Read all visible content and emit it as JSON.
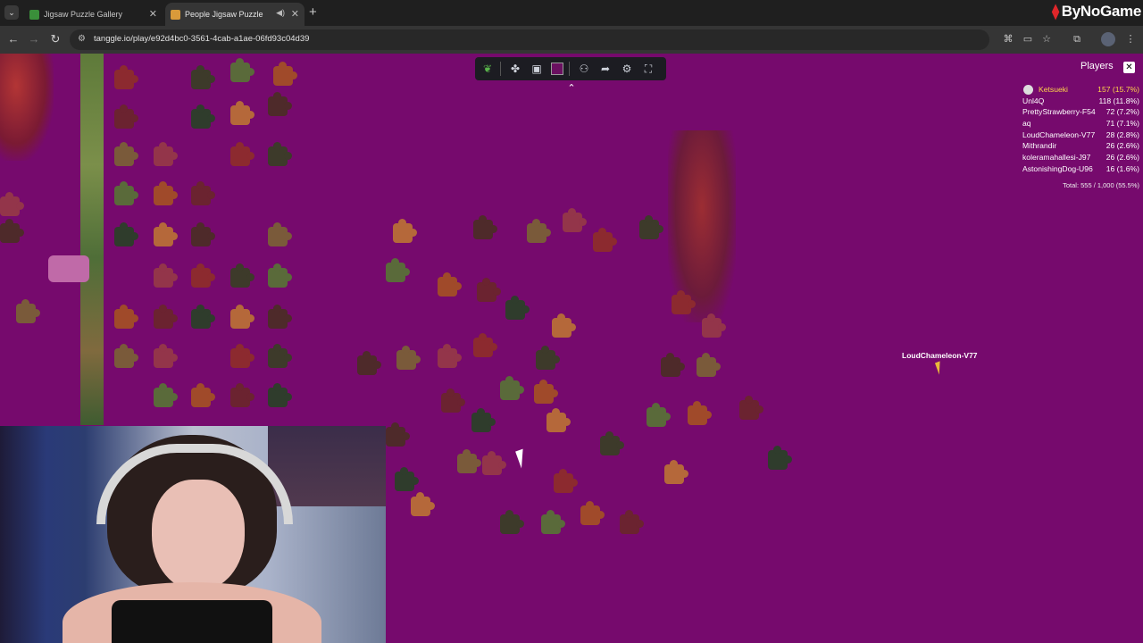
{
  "browser": {
    "tabs": [
      {
        "title": "Jigsaw Puzzle Gallery",
        "active": false
      },
      {
        "title": "People Jigsaw Puzzle",
        "active": true
      }
    ],
    "url": "tanggle.io/play/e92d4bc0-3561-4cab-a1ae-06fd93c04d39",
    "brand": "ByNoGame"
  },
  "game": {
    "players_title": "Players",
    "players": [
      {
        "name": "Ketsueki",
        "score": "157 (15.7%)",
        "leader": true
      },
      {
        "name": "Unl4Q",
        "score": "118 (11.8%)"
      },
      {
        "name": "PrettyStrawberry-F54",
        "score": "72 (7.2%)"
      },
      {
        "name": "aq",
        "score": "71 (7.1%)"
      },
      {
        "name": "LoudChameleon-V77",
        "score": "28 (2.8%)"
      },
      {
        "name": "Mithrandir",
        "score": "26 (2.6%)"
      },
      {
        "name": "koleramahallesi-J97",
        "score": "26 (2.6%)"
      },
      {
        "name": "AstonishingDog-U96",
        "score": "16 (1.6%)"
      }
    ],
    "total": "Total: 555 / 1,000 (55.5%)",
    "remote_cursor_label": "LoudChameleon-V77",
    "background_color": "#760a6d",
    "toolbar_icons": [
      "leaf-logo-icon",
      "puzzle-piece-icon",
      "image-preview-icon",
      "background-color-swatch",
      "players-icon",
      "share-icon",
      "settings-gear-icon",
      "fullscreen-icon"
    ],
    "collapse_icon": "chevrons-up-icon"
  }
}
